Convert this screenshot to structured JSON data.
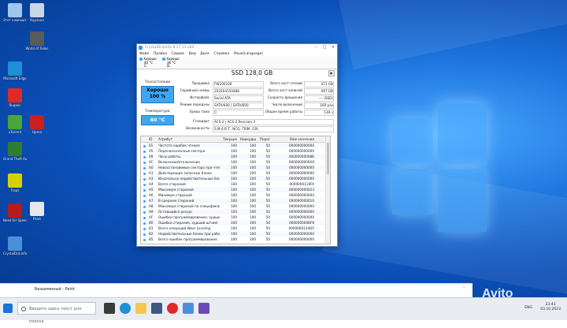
{
  "window": {
    "title": "CrystalDiskInfo 8.17.13 x64",
    "menu": [
      "Файл",
      "Правка",
      "Сервис",
      "Вид",
      "Диск",
      "Справка",
      "Язык(Language)"
    ],
    "drive_tabs": [
      {
        "status": "Хорошо",
        "temp": "40 °C",
        "letter": "C:"
      },
      {
        "status": "Хорошо",
        "temp": "36 °C",
        "letter": "D:"
      }
    ],
    "model": "SSD 128,0 GB",
    "health_label": "Техсостояние",
    "health_value": "Хорошо",
    "health_percent": "100 %",
    "temp_label": "Температура",
    "temp_value": "40 °C",
    "fields": {
      "firmware_label": "Прошивка",
      "firmware": "FW200326",
      "serial_label": "Серийный номер",
      "serial": "202204150488",
      "interface_label": "Интерфейс",
      "interface": "Serial ATA",
      "transfer_label": "Режим передачи",
      "transfer": "SATA/600 | SATA/600",
      "letter_label": "Буква тома",
      "letter": "C:",
      "standard_label": "Стандарт",
      "standard": "ACS-2 | ACS-2 Revision 3",
      "features_label": "Возможности",
      "features": "S.M.A.R.T., NCQ, TRIM, GPL",
      "reads_label": "Всего хост-чтений",
      "reads": "471 GB",
      "writes_label": "Всего хост-записей",
      "writes": "497 GB",
      "rpm_label": "Скорость вращения",
      "rpm": "---- (SSD)",
      "power_count_label": "Число включений",
      "power_count": "169 раз",
      "power_hours_label": "Общее время работы",
      "power_hours": "139 ч"
    },
    "table": {
      "headers": [
        "ID",
        "Атрибут",
        "Текущее",
        "Наихудш...",
        "Порог",
        "Raw-значения"
      ],
      "rows": [
        [
          "01",
          "Частота ошибок чтения",
          "100",
          "100",
          "50",
          "000000000000"
        ],
        [
          "05",
          "Переназначенные сектора",
          "100",
          "100",
          "50",
          "000000000000"
        ],
        [
          "09",
          "Часы работы",
          "100",
          "100",
          "50",
          "00000000008B"
        ],
        [
          "0C",
          "Включения/отключения",
          "100",
          "100",
          "50",
          "0000000000A9"
        ],
        [
          "A0",
          "Невосстановимые сектора при чтении/за...",
          "100",
          "100",
          "50",
          "000000000000"
        ],
        [
          "A1",
          "Действующие запасные блоки",
          "100",
          "100",
          "50",
          "000000000000"
        ],
        [
          "A3",
          "Изначально недействительные блоки",
          "100",
          "100",
          "50",
          "000000000000"
        ],
        [
          "A4",
          "Всего стираний",
          "100",
          "100",
          "50",
          "0000000110FA"
        ],
        [
          "A5",
          "Максимум стираний",
          "100",
          "100",
          "50",
          "000000000023"
        ],
        [
          "A6",
          "Минимум стираний",
          "100",
          "100",
          "50",
          "000000000004"
        ],
        [
          "A7",
          "В среднем стираний",
          "100",
          "100",
          "50",
          "000000000010"
        ],
        [
          "A8",
          "Максимум стираний по спецификации",
          "100",
          "100",
          "50",
          "000000000000"
        ],
        [
          "A9",
          "Оставшийся ресурс",
          "100",
          "100",
          "50",
          "000000000000"
        ],
        [
          "AF",
          "Ошибки программирования, худший шта...",
          "100",
          "100",
          "50",
          "000000000000"
        ],
        [
          "B0",
          "Ошибки стирания, худший штамп",
          "100",
          "100",
          "50",
          "000000000BF8"
        ],
        [
          "B1",
          "Всего операций Wear Leveling",
          "100",
          "100",
          "50",
          "0000000134D5"
        ],
        [
          "B2",
          "Недействительные блоки при работе",
          "100",
          "100",
          "50",
          "000000000000"
        ],
        [
          "B5",
          "Всего ошибок программирования",
          "100",
          "100",
          "50",
          "000000000000"
        ]
      ]
    }
  },
  "desktop_icons": [
    {
      "label": "Этот компьютер",
      "color": "#9fc7ee"
    },
    {
      "label": "Корзина",
      "color": "#c9d6e6"
    },
    {
      "label": "World of Tanks",
      "color": "#5a5a5a"
    },
    {
      "label": "Microsoft Edge",
      "color": "#1f8fd6"
    },
    {
      "label": "Яндекс",
      "color": "#e02a2a"
    },
    {
      "label": "uTorrent",
      "color": "#4aa63a"
    },
    {
      "label": "Opera",
      "color": "#cc2020"
    },
    {
      "label": "Grand Theft Auto V",
      "color": "#2e7d32"
    },
    {
      "label": "Fraps",
      "color": "#d8d000"
    },
    {
      "label": "Need for Speed",
      "color": "#b71c1c"
    },
    {
      "label": "Paint",
      "color": "#e8e8e8"
    },
    {
      "label": "CrystalDiskInfo",
      "color": "#4a90d9"
    }
  ],
  "taskbar": {
    "search_placeholder": "Введите здесь текст для поиска",
    "paint_title": "Безымянный - Paint",
    "lang": "ENG",
    "time": "23:41",
    "date": "03.10.2023"
  },
  "watermark": "Avito"
}
